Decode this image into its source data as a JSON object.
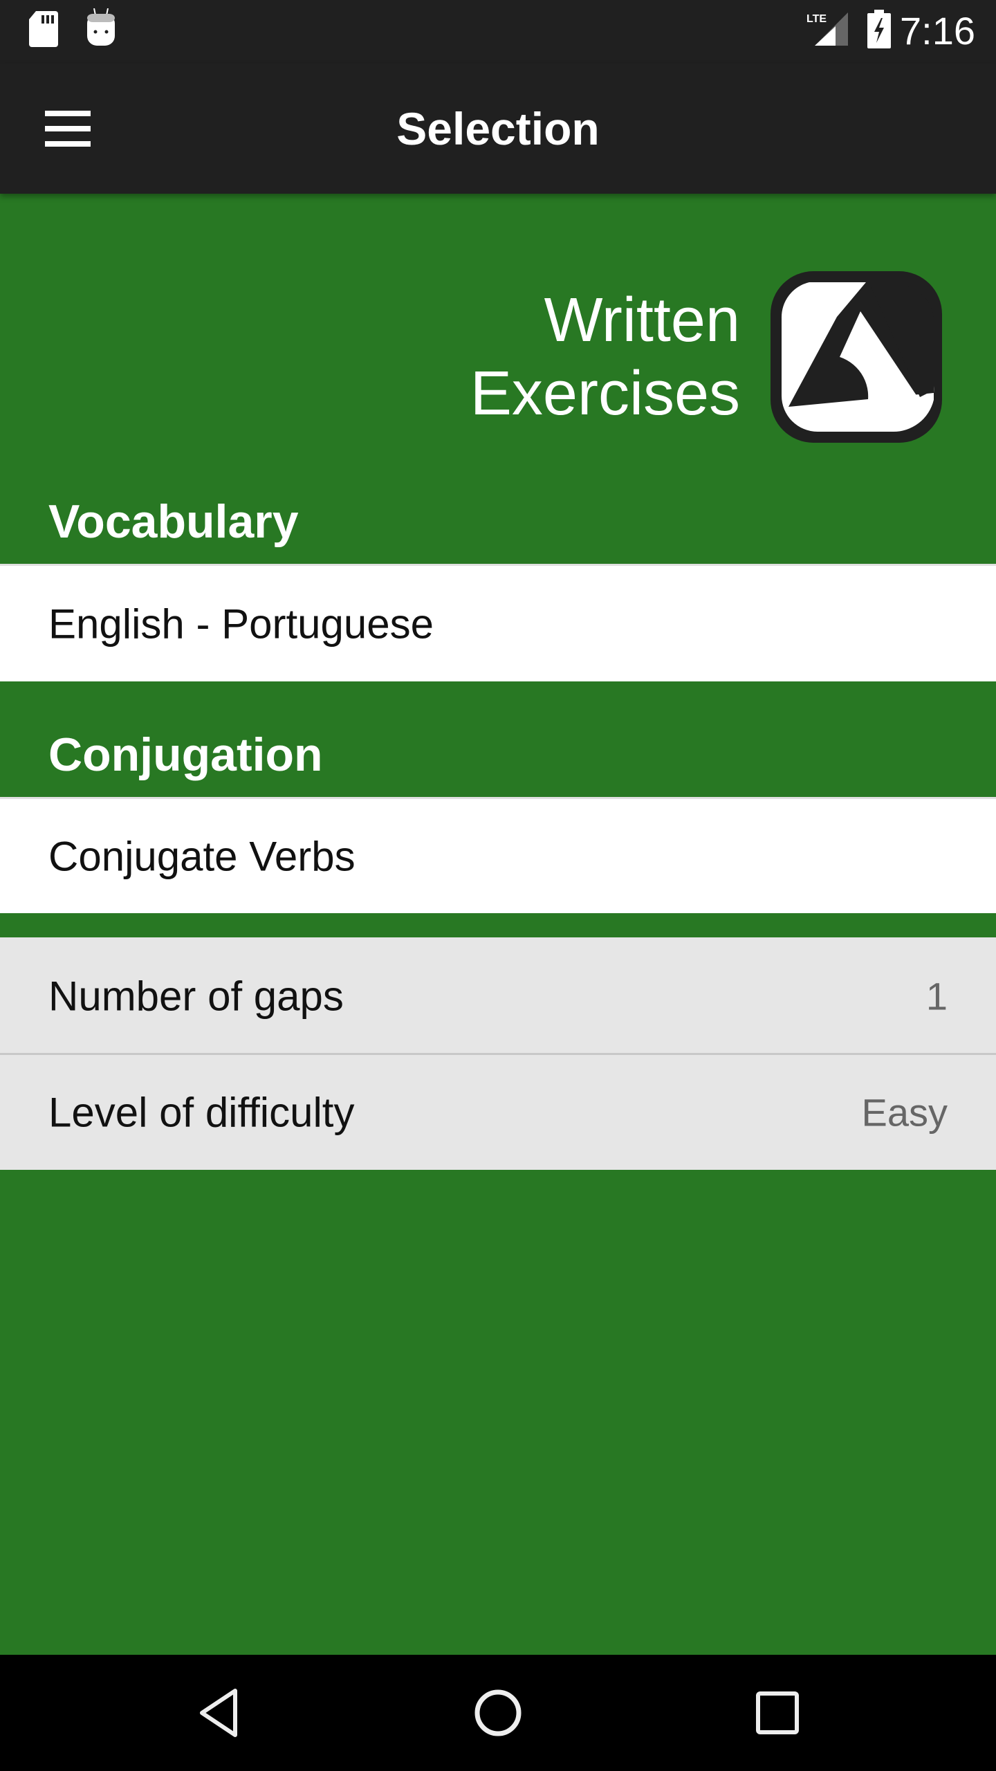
{
  "status_bar": {
    "time": "7:16",
    "network_label": "LTE",
    "icons": [
      "sd-card-icon",
      "android-debug-icon",
      "lte-signal-icon",
      "battery-charging-icon"
    ]
  },
  "toolbar": {
    "title": "Selection",
    "menu_icon": "hamburger-menu-icon"
  },
  "hero": {
    "title_line1": "Written",
    "title_line2": "Exercises",
    "logo_icon": "app-logo-icon"
  },
  "sections": [
    {
      "header": "Vocabulary",
      "items": [
        {
          "label": "English - Portuguese"
        }
      ]
    },
    {
      "header": "Conjugation",
      "items": [
        {
          "label": "Conjugate Verbs"
        }
      ]
    }
  ],
  "settings": [
    {
      "label": "Number of gaps",
      "value": "1"
    },
    {
      "label": "Level of difficulty",
      "value": "Easy"
    }
  ],
  "nav_bar": {
    "icons": [
      "back-icon",
      "home-icon",
      "recents-icon"
    ]
  },
  "colors": {
    "primary_green": "#287823",
    "toolbar_dark": "#202020",
    "settings_gray": "#e6e6e6"
  }
}
